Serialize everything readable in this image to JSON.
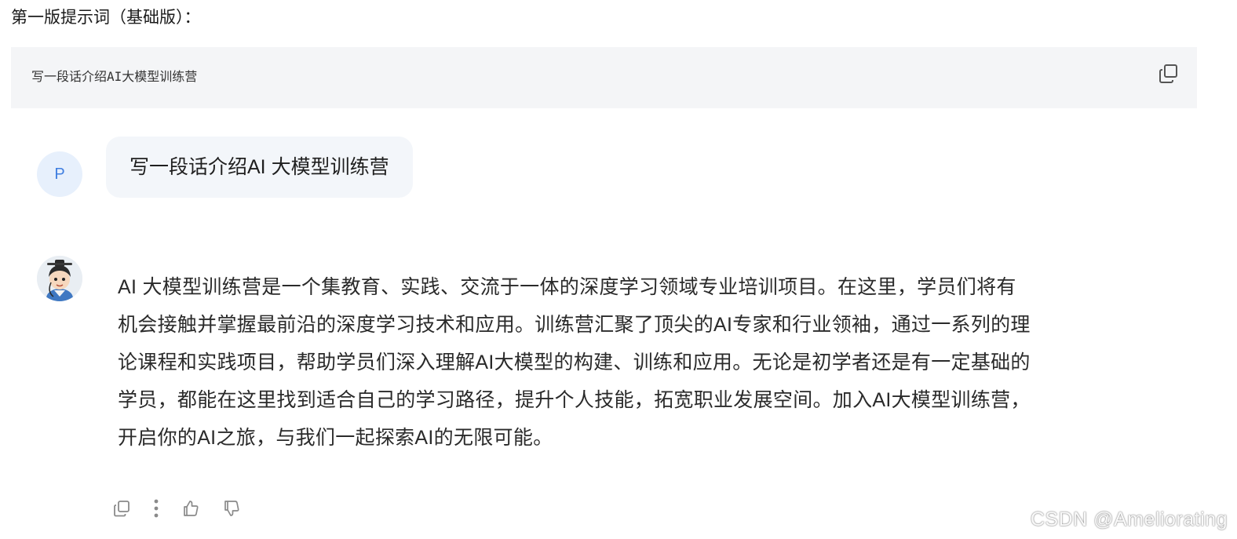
{
  "heading": "第一版提示词（基础版）：",
  "code_block": {
    "text": "写一段话介绍AI大模型训练营",
    "copy_icon": "copy-icon"
  },
  "conversation": {
    "user": {
      "avatar_letter": "P",
      "message": "写一段话介绍AI 大模型训练营"
    },
    "assistant": {
      "avatar_icon": "assistant-avatar-icon",
      "lines": [
        "AI 大模型训练营是一个集教育、实践、交流于一体的深度学习领域专业培训项目。在这里，学员们将有",
        "机会接触并掌握最前沿的深度学习技术和应用。训练营汇聚了顶尖的AI专家和行业领袖，通过一系列的理",
        "论课程和实践项目，帮助学员们深入理解AI大模型的构建、训练和应用。无论是初学者还是有一定基础的",
        "学员，都能在这里找到适合自己的学习路径，提升个人技能，拓宽职业发展空间。加入AI大模型训练营，",
        "开启你的AI之旅，与我们一起探索AI的无限可能。"
      ],
      "actions": [
        "copy-icon",
        "more-icon",
        "thumbs-up-icon",
        "thumbs-down-icon"
      ]
    }
  },
  "watermark": "CSDN @Ameliorating",
  "colors": {
    "code_bg": "#f4f5f7",
    "user_bubble_bg": "#f3f6fa",
    "user_avatar_bg": "#e7f0fc",
    "user_avatar_fg": "#3f7ee0"
  }
}
